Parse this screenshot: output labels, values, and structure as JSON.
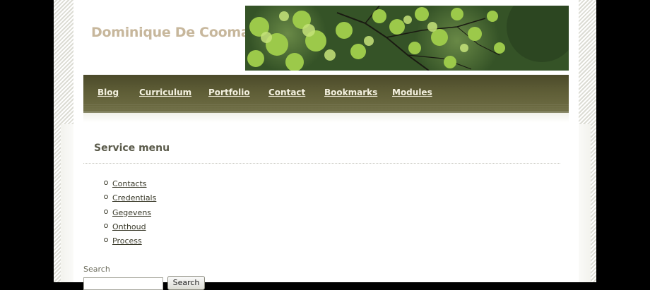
{
  "site": {
    "title": "Dominique De Cooman"
  },
  "banner": {
    "icon": "maple-leaves-photo"
  },
  "nav": {
    "items": [
      {
        "label": "Blog"
      },
      {
        "label": "Curriculum"
      },
      {
        "label": "Portfolio"
      },
      {
        "label": "Contact"
      },
      {
        "label": "Bookmarks"
      },
      {
        "label": "Modules"
      }
    ]
  },
  "service_menu": {
    "title": "Service menu",
    "items": [
      {
        "label": "Contacts"
      },
      {
        "label": "Credentials"
      },
      {
        "label": "Gegevens"
      },
      {
        "label": "Onthoud"
      },
      {
        "label": "Process"
      }
    ]
  },
  "search": {
    "label": "Search",
    "button_label": "Search",
    "value": ""
  },
  "colors": {
    "nav_bg": "#5e5d36",
    "title": "#c7b79c",
    "link": "#3a3a2a"
  }
}
